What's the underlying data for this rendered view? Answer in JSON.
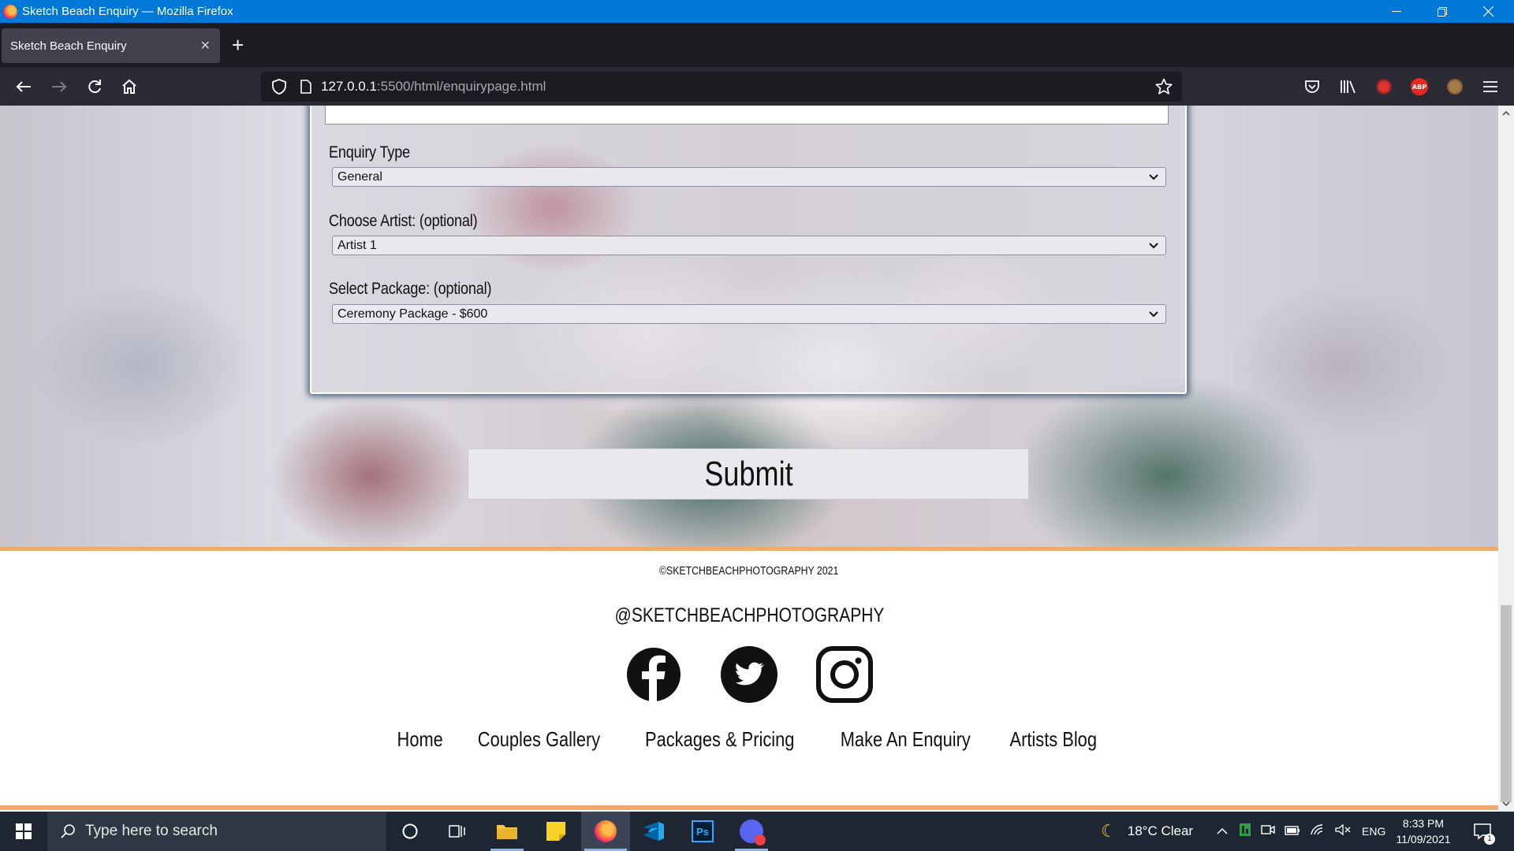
{
  "window": {
    "title": "Sketch Beach Enquiry — Mozilla Firefox",
    "minimize": "—",
    "restore": "❐",
    "close": "✕"
  },
  "tabs": [
    {
      "label": "Sketch Beach Enquiry",
      "close": "✕"
    }
  ],
  "new_tab": "+",
  "address_bar": {
    "host": "127.0.0.1",
    "path": ":5500/html/enquirypage.html"
  },
  "toolbar": {
    "abp_label": "ABP"
  },
  "form": {
    "enquiry_type": {
      "label": "Enquiry Type",
      "selected": "General"
    },
    "artist": {
      "label": "Choose Artist: (optional)",
      "selected": "Artist 1"
    },
    "package": {
      "label": "Select Package: (optional)",
      "selected": "Ceremony Package - $600"
    },
    "submit_label": "Submit"
  },
  "footer": {
    "copyright": "©SKETCHBEACHPHOTOGRAPHY 2021",
    "handle": "@SKETCHBEACHPHOTOGRAPHY",
    "social": [
      "facebook",
      "twitter",
      "instagram"
    ],
    "nav": [
      "Home",
      "Couples Gallery",
      "Packages & Pricing",
      "Make An Enquiry",
      "Artists Blog"
    ]
  },
  "taskbar": {
    "search_placeholder": "Type here to search",
    "weather": "18°C  Clear",
    "language": "ENG",
    "time": "8:33 PM",
    "date": "11/09/2021",
    "notification_count": "1",
    "ps_label": "Ps"
  },
  "colors": {
    "accent_line": "#efab6d",
    "titlebar": "#0078d7",
    "form_glow": "#233c5f"
  }
}
